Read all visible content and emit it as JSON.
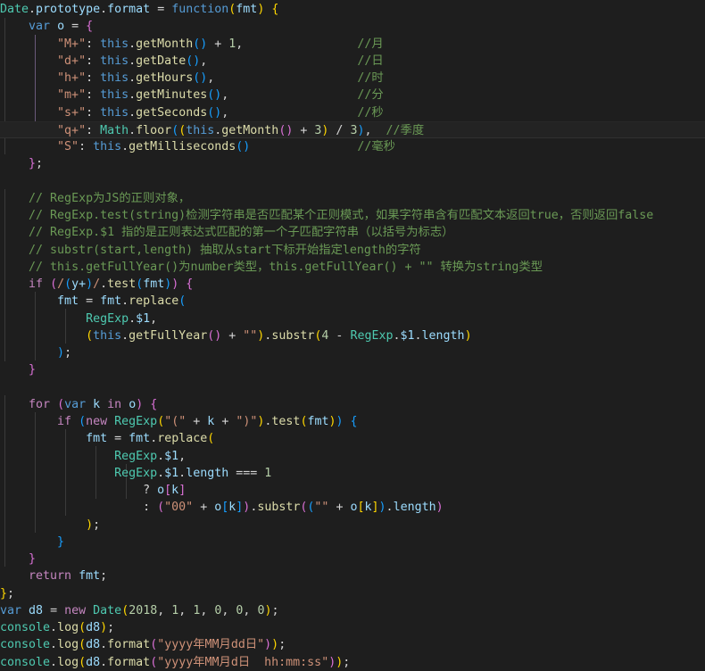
{
  "editor": {
    "theme_name": "dark-plus",
    "background": "#1e1e1e",
    "foreground": "#d4d4d4",
    "active_line_background": "#232323",
    "indent_guide_color": "#3b3b3b",
    "active_indent_guide_color": "#6a5a7a",
    "font_size_px": 13.3,
    "line_height_px": 19.25,
    "language": "javascript",
    "active_line_number": 8
  },
  "colors": {
    "keyword": "#c586c0",
    "keyword_blue": "#569cd6",
    "function": "#dcdcaa",
    "variable": "#9cdcfe",
    "string": "#ce9178",
    "number": "#b5cea8",
    "comment": "#6a9955",
    "class": "#4ec9b0",
    "bracket_1": "#ffd700",
    "bracket_2": "#da70d6",
    "bracket_3": "#179fff"
  },
  "code": {
    "lines": [
      "Date.prototype.format = function(fmt) {",
      "    var o = {",
      "        \"M+\": this.getMonth() + 1,                //月",
      "        \"d+\": this.getDate(),                     //日",
      "        \"h+\": this.getHours(),                    //时",
      "        \"m+\": this.getMinutes(),                  //分",
      "        \"s+\": this.getSeconds(),                  //秒",
      "        \"q+\": Math.floor((this.getMonth() + 3) / 3),  //季度",
      "        \"S\": this.getMilliseconds()               //毫秒",
      "    };",
      "",
      "    // RegExp为JS的正则对象，",
      "    // RegExp.test(string)检测字符串是否匹配某个正则模式，如果字符串含有匹配文本返回true，否则返回false",
      "    // RegExp.$1 指的是正则表达式匹配的第一个子匹配字符串（以括号为标志）",
      "    // substr(start,length) 抽取从start下标开始指定length的字符",
      "    // this.getFullYear()为number类型，this.getFullYear() + \"\" 转换为string类型",
      "    if (/(y+)/.test(fmt)) {",
      "        fmt = fmt.replace(",
      "            RegExp.$1,",
      "            (this.getFullYear() + \"\").substr(4 - RegExp.$1.length)",
      "        );",
      "    }",
      "",
      "    for (var k in o) {",
      "        if (new RegExp(\"(\" + k + \")\").test(fmt)) {",
      "            fmt = fmt.replace(",
      "                RegExp.$1,",
      "                RegExp.$1.length === 1",
      "                    ? o[k]",
      "                    : (\"00\" + o[k]).substr((\"\" + o[k]).length)",
      "            );",
      "        }",
      "    }",
      "    return fmt;",
      "};",
      "var d8 = new Date(2018, 1, 1, 0, 0, 0);",
      "console.log(d8);",
      "console.log(d8.format(\"yyyy年MM月dd日\"));",
      "console.log(d8.format(\"yyyy年MM月d日  hh:mm:ss\"));"
    ],
    "inline_comments": {
      "month": "//月",
      "day": "//日",
      "hour": "//时",
      "minute": "//分",
      "second": "//秒",
      "quarter": "//季度",
      "millisecond": "//毫秒"
    },
    "block_comments": [
      "// RegExp为JS的正则对象，",
      "// RegExp.test(string)检测字符串是否匹配某个正则模式，如果字符串含有匹配文本返回true，否则返回false",
      "// RegExp.$1 指的是正则表达式匹配的第一个子匹配字符串（以括号为标志）",
      "// substr(start,length) 抽取从start下标开始指定length的字符",
      "// this.getFullYear()为number类型，this.getFullYear() + \"\" 转换为string类型"
    ],
    "format_keys": [
      "M+",
      "d+",
      "h+",
      "m+",
      "s+",
      "q+",
      "S"
    ],
    "date_args": [
      "2018",
      "1",
      "1",
      "0",
      "0",
      "0"
    ],
    "format_patterns": [
      "yyyy年MM月dd日",
      "yyyy年MM月d日  hh:mm:ss"
    ]
  }
}
